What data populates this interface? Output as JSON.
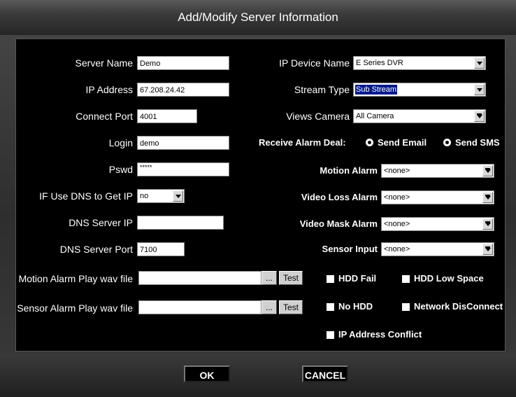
{
  "title": "Add/Modify Server Information",
  "left": {
    "server_name": {
      "label": "Server Name",
      "value": "Demo"
    },
    "ip_address": {
      "label": "IP Address",
      "value": "67.208.24.42"
    },
    "connect_port": {
      "label": "Connect Port",
      "value": "4001"
    },
    "login": {
      "label": "Login",
      "value": "demo"
    },
    "pswd": {
      "label": "Pswd",
      "value": "*****"
    },
    "use_dns": {
      "label": "IF Use DNS to Get IP",
      "value": "no"
    },
    "dns_server_ip": {
      "label": "DNS Server IP",
      "value": ""
    },
    "dns_server_port": {
      "label": "DNS Server Port",
      "value": "7100"
    },
    "motion_wav": {
      "label": "Motion Alarm Play wav file",
      "value": "",
      "browse": "...",
      "test": "Test"
    },
    "sensor_wav": {
      "label": "Sensor Alarm Play wav file",
      "value": "",
      "browse": "...",
      "test": "Test"
    }
  },
  "right": {
    "ip_device_name": {
      "label": "IP Device Name",
      "value": "E Series DVR"
    },
    "stream_type": {
      "label": "Stream Type",
      "value": "Sub Stream"
    },
    "views_camera": {
      "label": "Views Camera",
      "value": "All Camera"
    },
    "receive_alarm": {
      "label": "Receive Alarm  Deal:",
      "send_email": "Send Email",
      "send_sms": "Send SMS"
    },
    "motion_alarm": {
      "label": "Motion Alarm",
      "value": "<none>"
    },
    "video_loss_alarm": {
      "label": "Video Loss Alarm",
      "value": "<none>"
    },
    "video_mask_alarm": {
      "label": "Video Mask Alarm",
      "value": "<none>"
    },
    "sensor_input": {
      "label": "Sensor Input",
      "value": "<none>"
    },
    "checks": {
      "hdd_fail": "HDD Fail",
      "hdd_low_space": "HDD Low Space",
      "no_hdd": "No HDD",
      "network_disconnect": "Network DisConnect",
      "ip_conflict": "IP Address Conflict"
    }
  },
  "buttons": {
    "ok": "OK",
    "cancel": "CANCEL"
  }
}
